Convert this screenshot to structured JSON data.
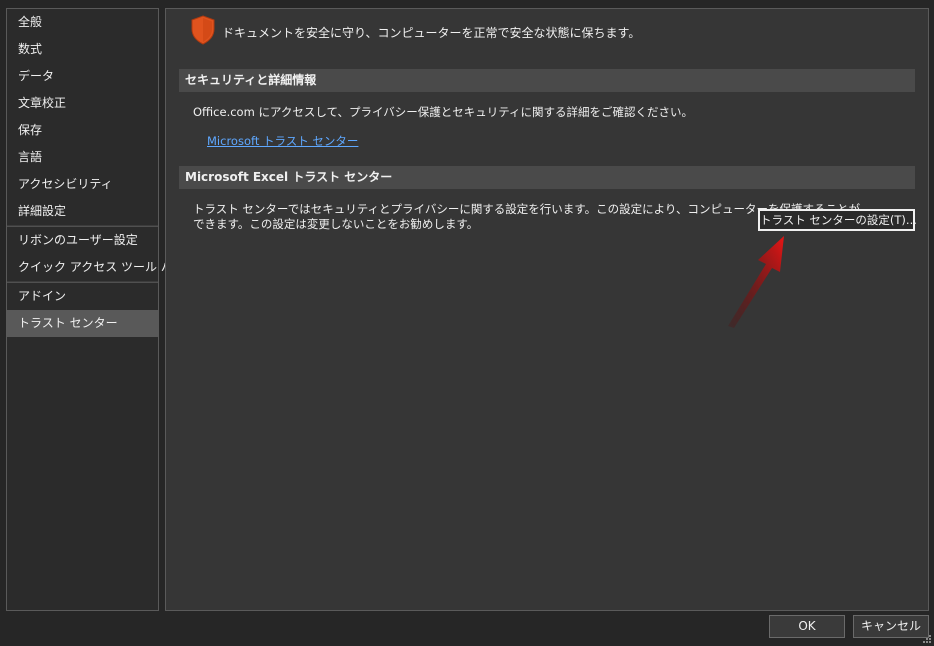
{
  "sidebar": {
    "items": [
      {
        "label": "全般"
      },
      {
        "label": "数式"
      },
      {
        "label": "データ"
      },
      {
        "label": "文章校正"
      },
      {
        "label": "保存"
      },
      {
        "label": "言語"
      },
      {
        "label": "アクセシビリティ"
      },
      {
        "label": "詳細設定"
      },
      {
        "label": "リボンのユーザー設定"
      },
      {
        "label": "クイック アクセス ツール バー"
      },
      {
        "label": "アドイン"
      },
      {
        "label": "トラスト センター"
      }
    ],
    "selected": "トラスト センター"
  },
  "header": {
    "icon": "shield-icon",
    "text": "ドキュメントを安全に守り、コンピューターを正常で安全な状態に保ちます。"
  },
  "security_section": {
    "title": "セキュリティと詳細情報",
    "description": "Office.com にアクセスして、プライバシー保護とセキュリティに関する詳細をご確認ください。",
    "link": "Microsoft トラスト センター"
  },
  "trust_center_section": {
    "title": "Microsoft Excel トラスト センター",
    "description_line1": "トラスト センターではセキュリティとプライバシーに関する設定を行います。この設定により、コンピューターを保護することが",
    "description_line2": "できます。この設定は変更しないことをお勧めします。",
    "button": "トラスト センターの設定(T)..."
  },
  "footer": {
    "ok": "OK",
    "cancel": "キャンセル"
  },
  "colors": {
    "shield": "#e0531e",
    "link": "#5fa8ff",
    "arrow": "#d81010"
  }
}
